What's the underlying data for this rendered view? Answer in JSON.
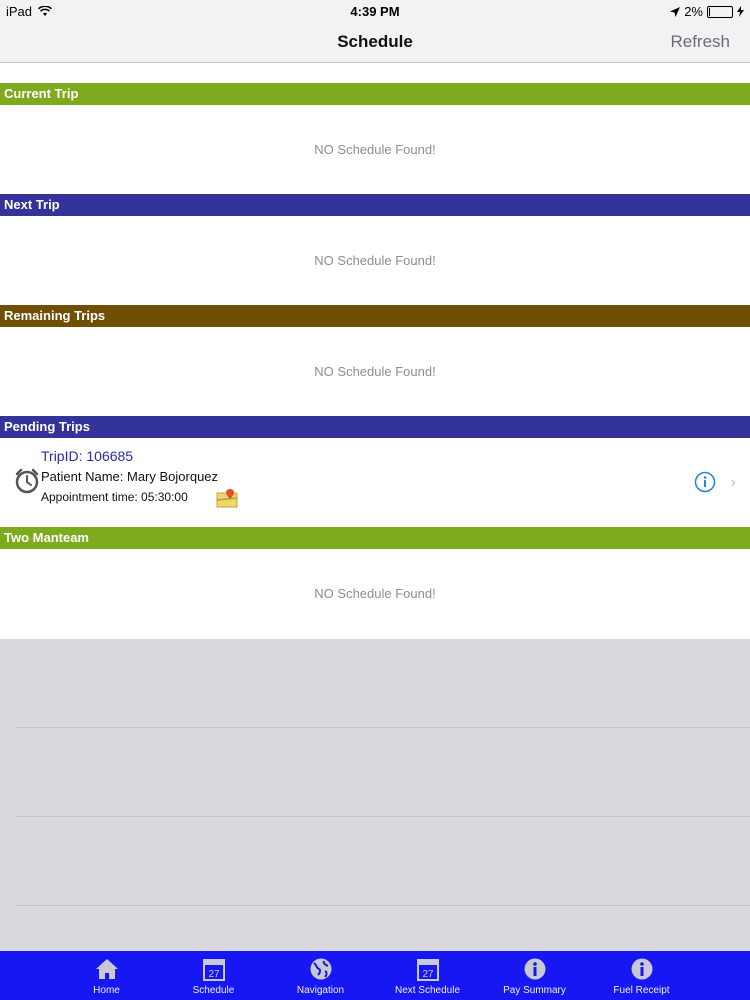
{
  "status_bar": {
    "device": "iPad",
    "time": "4:39 PM",
    "battery": "2%"
  },
  "nav": {
    "title": "Schedule",
    "refresh": "Refresh"
  },
  "colors": {
    "current_trip": "#7eaa1e",
    "next_trip": "#333399",
    "remaining_trips": "#6e4f04",
    "pending_trips": "#333399",
    "two_manteam": "#7eaa1e",
    "tab_bar": "#1717f4"
  },
  "sections": {
    "current_trip": {
      "title": "Current Trip",
      "empty": "NO Schedule Found!"
    },
    "next_trip": {
      "title": "Next Trip",
      "empty": "NO Schedule Found!"
    },
    "remaining_trips": {
      "title": "Remaining Trips",
      "empty": "NO Schedule Found!"
    },
    "pending_trips": {
      "title": "Pending Trips",
      "trip": {
        "trip_id": "TripID: 106685",
        "patient": "Patient Name: Mary Bojorquez",
        "appointment": "Appointment time: 05:30:00"
      }
    },
    "two_manteam": {
      "title": "Two Manteam",
      "empty": "NO Schedule Found!"
    }
  },
  "tabs": [
    {
      "label": "Home",
      "icon": "home-icon"
    },
    {
      "label": "Schedule",
      "icon": "calendar-icon",
      "day": "27"
    },
    {
      "label": "Navigation",
      "icon": "globe-icon"
    },
    {
      "label": "Next Schedule",
      "icon": "calendar-icon",
      "day": "27"
    },
    {
      "label": "Pay Summary",
      "icon": "info-icon"
    },
    {
      "label": "Fuel Receipt",
      "icon": "info-icon"
    }
  ]
}
